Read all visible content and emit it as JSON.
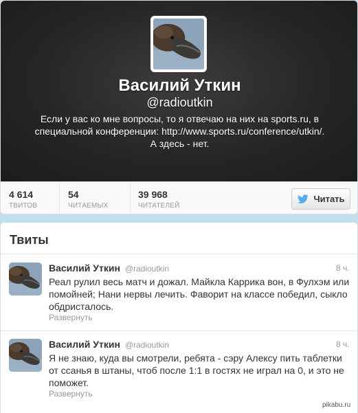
{
  "profile": {
    "name": "Василий Уткин",
    "screen_name": "@radioutkin",
    "bio_lines": [
      "Если у вас ко мне вопросы, то я отвечаю на них на sports.ru, в",
      "специальной конференции: http://www.sports.ru/conference/utkin/.",
      "А здесь - нет."
    ],
    "stats": [
      {
        "value": "4 614",
        "label": "ТВИТОВ"
      },
      {
        "value": "54",
        "label": "ЧИТАЕМЫХ"
      },
      {
        "value": "39 968",
        "label": "ЧИТАТЕЛЕЙ"
      }
    ],
    "follow_label": "Читать",
    "header_color": "#262626"
  },
  "tweets_section": {
    "title": "Твиты",
    "items": [
      {
        "name": "Василий Уткин",
        "handle": "@radioutkin",
        "time": "8 ч.",
        "text": "Реал рулил весь матч и дожал. Майкла Каррика вон, в Фулхэм или помойней; Нани нервы лечить. Фаворит на классе победил, сыкло обдристалось.",
        "expand": "Развернуть"
      },
      {
        "name": "Василий Уткин",
        "handle": "@radioutkin",
        "time": "8 ч.",
        "text": "Я не знаю, куда вы смотрели, ребята - сэру Алексу пить таблетки от ссанья в штаны, чтоб после 1:1 в гостях не играл на 0, и это не поможет.",
        "expand": "Развернуть"
      }
    ]
  },
  "watermark": "pikabu.ru",
  "colors": {
    "accent": "#0084b4",
    "background": "#c0deed"
  }
}
